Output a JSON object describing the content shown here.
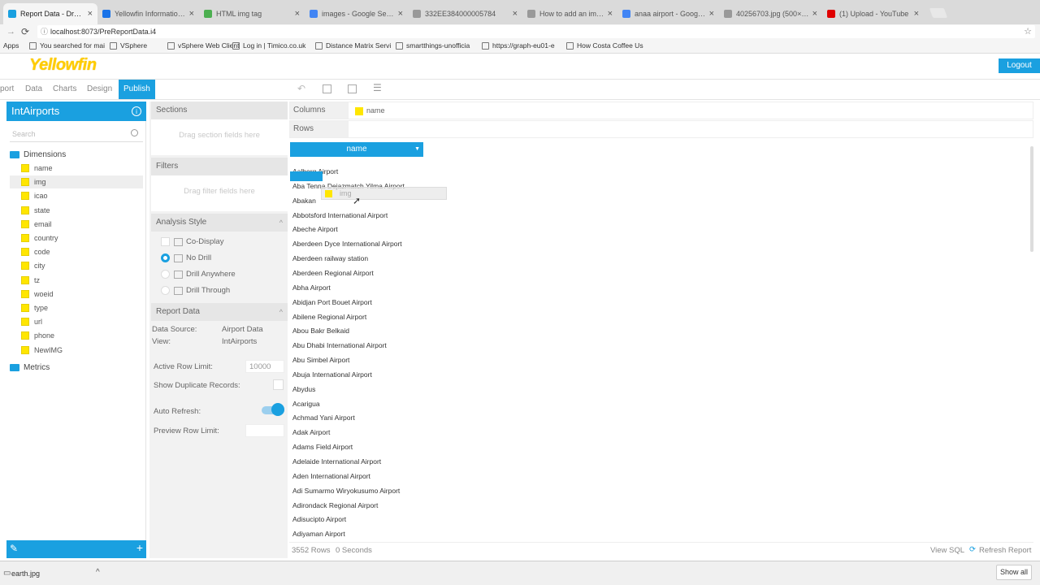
{
  "browser": {
    "tabs": [
      {
        "title": "Report Data - Draft Rep",
        "color": "#1aa0e0",
        "active": true
      },
      {
        "title": "Yellowfin Information C",
        "color": "#1a73e8"
      },
      {
        "title": "HTML img tag",
        "color": "#4caf50"
      },
      {
        "title": "images - Google Searc",
        "color": "#4285f4"
      },
      {
        "title": "332EE384000005784",
        "color": "#999999"
      },
      {
        "title": "How to add an image",
        "color": "#999999"
      },
      {
        "title": "anaa airport - Google S",
        "color": "#4285f4"
      },
      {
        "title": "40256703.jpg (500×33",
        "color": "#999999"
      },
      {
        "title": "(1) Upload - YouTube",
        "color": "#e00000"
      }
    ],
    "url": "localhost:8073/PreReportData.i4",
    "bookmarks": [
      "Apps",
      "You searched for mai",
      "VSphere",
      "vSphere Web Client",
      "Log in | Timico.co.uk",
      "Distance Matrix Servi",
      "smartthings-unofficia",
      "https://graph-eu01-e",
      "How Costa Coffee Us"
    ]
  },
  "app": {
    "logo": "Yellowfin",
    "logout": "Logout",
    "steps": [
      "port",
      "Data",
      "Charts",
      "Design",
      "Publish"
    ]
  },
  "left": {
    "title": "IntAirports",
    "search_placeholder": "Search",
    "dimensions_label": "Dimensions",
    "fields": [
      "name",
      "img",
      "icao",
      "state",
      "email",
      "country",
      "code",
      "city",
      "tz",
      "woeid",
      "type",
      "url",
      "phone",
      "NewIMG"
    ],
    "metrics_label": "Metrics"
  },
  "middle": {
    "sections_label": "Sections",
    "sections_hint": "Drag section fields here",
    "filters_label": "Filters",
    "filters_hint": "Drag filter fields here",
    "analysis_label": "Analysis Style",
    "options": [
      "Co-Display",
      "No Drill",
      "Drill Anywhere",
      "Drill Through"
    ],
    "report_data_label": "Report Data",
    "data_source_key": "Data Source:",
    "data_source_val": "Airport Data",
    "view_key": "View:",
    "view_val": "IntAirports",
    "row_limit_key": "Active Row Limit:",
    "row_limit_val": "10000",
    "dup_key": "Show Duplicate Records:",
    "auto_refresh_key": "Auto Refresh:",
    "preview_key": "Preview Row Limit:"
  },
  "main": {
    "columns_label": "Columns",
    "columns_field": "name",
    "rows_label": "Rows",
    "col_header": "name",
    "drag_ghost": "img",
    "rows": [
      "Aalborg Airport",
      "Aba Tenna Dejazmatch Yilma Airport",
      "Abakan",
      "Abbotsford International Airport",
      "Abeche Airport",
      "Aberdeen Dyce International Airport",
      "Aberdeen railway station",
      "Aberdeen Regional Airport",
      "Abha Airport",
      "Abidjan Port Bouet Airport",
      "Abilene Regional Airport",
      "Abou Bakr Belkaid",
      "Abu Dhabi International Airport",
      "Abu Simbel Airport",
      "Abuja International Airport",
      "Abydus",
      "Acarigua",
      "Achmad Yani Airport",
      "Adak Airport",
      "Adams Field Airport",
      "Adelaide International Airport",
      "Aden International Airport",
      "Adi Sumarmo Wiryokusumo Airport",
      "Adirondack Regional Airport",
      "Adisucipto Airport",
      "Adiyaman Airport"
    ],
    "row_count": "3552 Rows",
    "time": "0 Seconds",
    "view_sql": "View SQL",
    "refresh": "Refresh Report"
  },
  "downloads": {
    "file": "earth.jpg",
    "show_all": "Show all"
  }
}
